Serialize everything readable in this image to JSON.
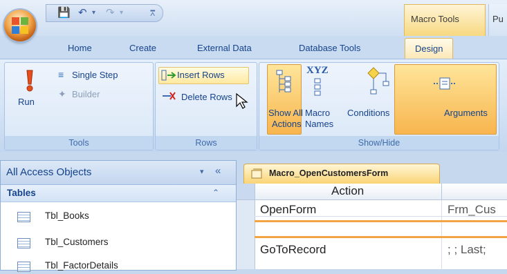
{
  "window": {
    "context_tab": "Macro Tools",
    "next_context_tab": "Pu"
  },
  "tabs": [
    {
      "label": "Home"
    },
    {
      "label": "Create"
    },
    {
      "label": "External Data"
    },
    {
      "label": "Database Tools"
    },
    {
      "label": "Design"
    }
  ],
  "ribbon": {
    "tools": {
      "run": "Run",
      "single_step": "Single Step",
      "builder": "Builder",
      "label": "Tools"
    },
    "rows": {
      "insert_rows": "Insert Rows",
      "delete_rows": "Delete Rows",
      "label": "Rows"
    },
    "showhide": {
      "show_all_actions_1": "Show All",
      "show_all_actions_2": "Actions",
      "macro_names_1": "Macro",
      "macro_names_2": "Names",
      "xyz": "XYZ",
      "conditions": "Conditions",
      "arguments": "Arguments",
      "label": "Show/Hide"
    }
  },
  "nav": {
    "title": "All Access Objects",
    "section": "Tables",
    "items": [
      {
        "label": "Tbl_Books"
      },
      {
        "label": "Tbl_Customers"
      },
      {
        "label": "Tbl_FactorDetails"
      }
    ]
  },
  "document": {
    "tab_title": "Macro_OpenCustomersForm",
    "column_header": "Action",
    "rows": [
      {
        "action": "OpenForm",
        "args": "Frm_Cus"
      },
      {
        "action": "",
        "args": ""
      },
      {
        "action": "GoToRecord",
        "args": "; ; Last;"
      }
    ]
  }
}
